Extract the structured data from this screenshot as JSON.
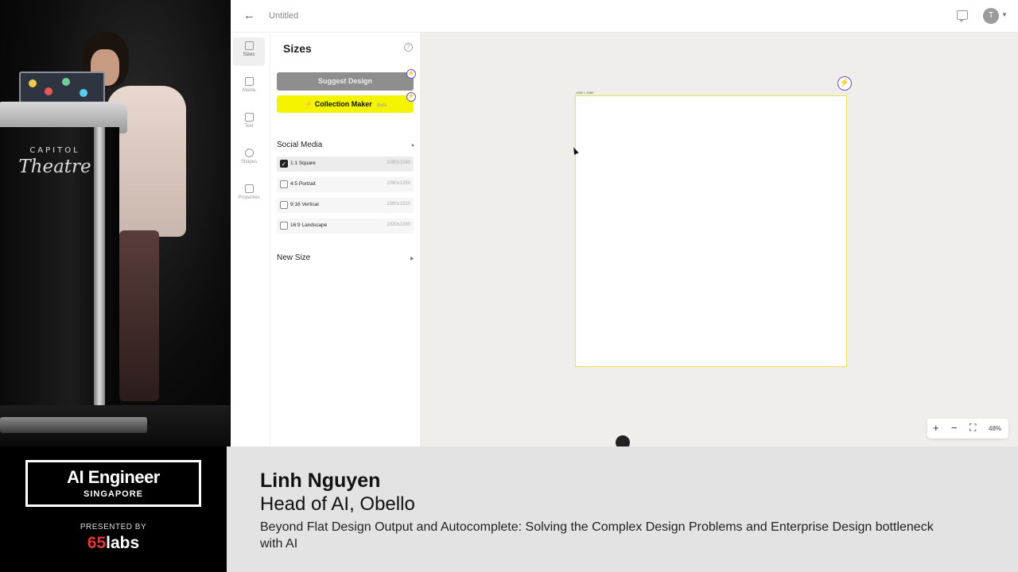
{
  "stage": {
    "venue_top": "CAPITOL",
    "venue_main": "Theatre"
  },
  "app": {
    "doc_title": "Untitled",
    "avatar_initial": "T",
    "rail": [
      {
        "label": "Sizes",
        "icon": "sizes-icon"
      },
      {
        "label": "Media",
        "icon": "media-icon"
      },
      {
        "label": "Text",
        "icon": "text-icon"
      },
      {
        "label": "Shapes",
        "icon": "shapes-icon"
      },
      {
        "label": "Properties",
        "icon": "properties-icon"
      }
    ],
    "panel": {
      "title": "Sizes",
      "suggest_label": "Suggest Design",
      "collection_label": "Collection Maker",
      "collection_badge": "beta",
      "social_title": "Social Media",
      "sizes": [
        {
          "name": "1:1 Square",
          "dim": "1080x1080",
          "checked": true
        },
        {
          "name": "4:5 Portrait",
          "dim": "1080x1350",
          "checked": false
        },
        {
          "name": "9:16 Vertical",
          "dim": "1080x1920",
          "checked": false
        },
        {
          "name": "16:9 Landscape",
          "dim": "1920x1080",
          "checked": false
        }
      ],
      "new_size_title": "New Size"
    },
    "canvas": {
      "artboard_label": "1080 × 1080",
      "zoom_level": "48%"
    },
    "colors": {
      "accent_purple": "#6a4cd1",
      "collection_yellow": "#f4f400",
      "artboard_border": "#ece14a"
    }
  },
  "lower_third": {
    "event_title": "AI Engineer",
    "event_location": "SINGAPORE",
    "presented_by": "PRESENTED BY",
    "sponsor_num": "65",
    "sponsor_word": "labs",
    "speaker_name": "Linh Nguyen",
    "speaker_role": "Head of AI, Obello",
    "talk_title": "Beyond Flat Design Output and Autocomplete: Solving the Complex Design Problems and Enterprise Design bottleneck with AI"
  }
}
